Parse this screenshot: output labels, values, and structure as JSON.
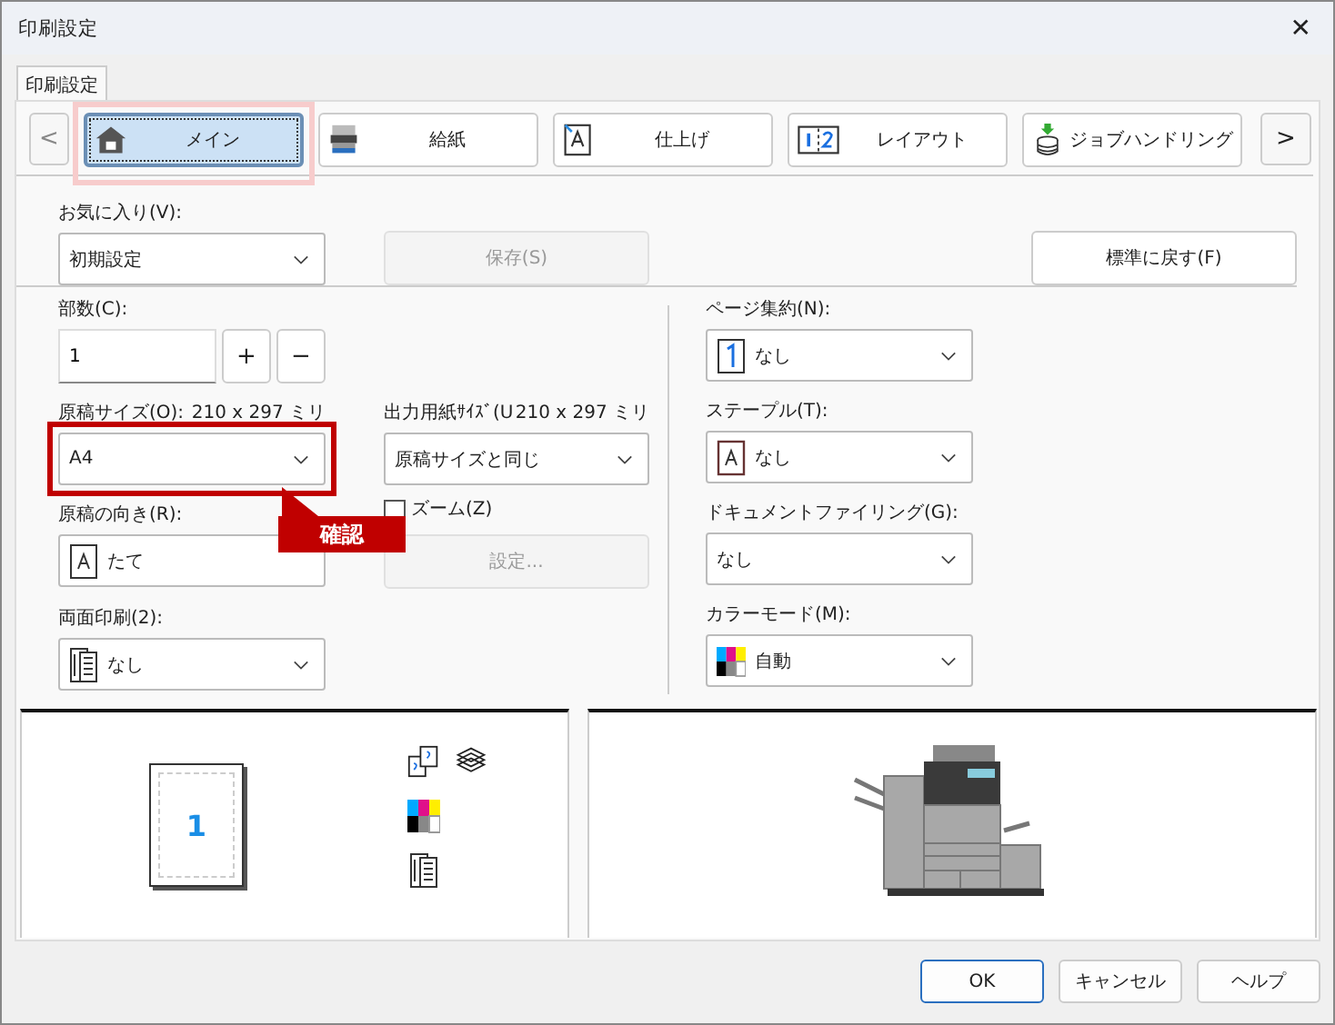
{
  "window": {
    "title": "印刷設定",
    "close": "✕"
  },
  "page_tab": {
    "label": "印刷設定",
    "selected": true
  },
  "nav": {
    "prev": "<",
    "next": ">"
  },
  "tabs": [
    {
      "label": "メイン",
      "kind": "home",
      "selected": true,
      "highlighted": true
    },
    {
      "label": "給紙",
      "kind": "paper_tray",
      "selected": false,
      "highlighted": false
    },
    {
      "label": "仕上げ",
      "kind": "finishing",
      "selected": false,
      "highlighted": false
    },
    {
      "label": "レイアウト",
      "kind": "layout",
      "selected": false,
      "highlighted": false
    },
    {
      "label": "ジョブハンドリング",
      "kind": "job_handling",
      "selected": false,
      "highlighted": false
    }
  ],
  "favorites": {
    "label": "お気に入り(V):",
    "value": "初期設定"
  },
  "save_button": {
    "label": "保存(S)",
    "disabled": true
  },
  "reset_button": {
    "label": "標準に戻す(F)",
    "disabled": false
  },
  "copies": {
    "label": "部数(C):",
    "value": "1",
    "plus": "+",
    "minus": "−"
  },
  "original_size": {
    "label": "原稿サイズ(O):",
    "size": "210 x 297 ミリ",
    "value": "A4",
    "highlighted": true
  },
  "output_size": {
    "label": "出力用紙ｻｲｽﾞ(U",
    "size": "210 x 297 ミリ",
    "value": "原稿サイズと同じ",
    "highlighted": false
  },
  "orientation": {
    "label": "原稿の向き(R):",
    "value": "たて",
    "kind": "portrait"
  },
  "callout": {
    "text": "確認"
  },
  "zoom": {
    "label": "ズーム(Z)",
    "checked": false
  },
  "settings_button": {
    "label": "設定...",
    "disabled": true
  },
  "duplex": {
    "label": "両面印刷(2):",
    "value": "なし",
    "kind": "duplex"
  },
  "right_fields": [
    {
      "label": "ページ集約(N):",
      "value": "なし",
      "kind": "pages_one"
    },
    {
      "label": "ステープル(T):",
      "value": "なし",
      "kind": "staple"
    },
    {
      "label": "ドキュメントファイリング(G):",
      "value": "なし",
      "kind": "plain"
    },
    {
      "label": "カラーモード(M):",
      "value": "自動",
      "kind": "color"
    }
  ],
  "preview": {
    "page_number": "1"
  },
  "buttons": [
    {
      "label": "OK",
      "selected": true
    },
    {
      "label": "キャンセル",
      "selected": false
    },
    {
      "label": "ヘルプ",
      "selected": false
    }
  ]
}
